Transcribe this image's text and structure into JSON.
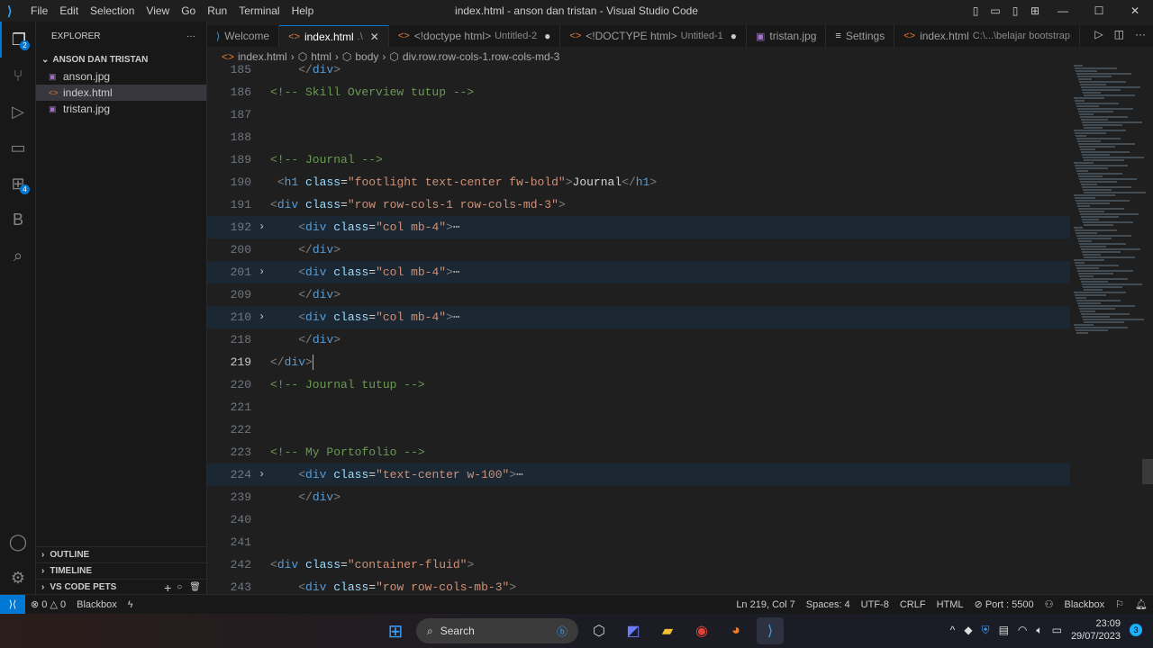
{
  "titlebar": {
    "menu": [
      "File",
      "Edit",
      "Selection",
      "View",
      "Go",
      "Run",
      "Terminal",
      "Help"
    ],
    "title": "index.html - anson dan tristan - Visual Studio Code"
  },
  "activity": {
    "explorer_badge": "2",
    "extensions_badge": "4",
    "blackbox_label": "B"
  },
  "sidebar": {
    "header": "EXPLORER",
    "folder": "ANSON DAN TRISTAN",
    "files": [
      "anson.jpg",
      "index.html",
      "tristan.jpg"
    ],
    "sections": [
      "OUTLINE",
      "TIMELINE",
      "VS CODE PETS"
    ]
  },
  "tabs": [
    {
      "label": "Welcome",
      "sub": "",
      "dot": false
    },
    {
      "label": "index.html",
      "sub": ".\\",
      "dot": false,
      "active": true
    },
    {
      "label": "<!doctype html>",
      "sub": "Untitled-2",
      "dot": true
    },
    {
      "label": "<!DOCTYPE html>",
      "sub": "Untitled-1",
      "dot": true
    },
    {
      "label": "tristan.jpg",
      "sub": "",
      "dot": false
    },
    {
      "label": "Settings",
      "sub": "",
      "dot": false
    },
    {
      "label": "index.html",
      "sub": "C:\\...\\belajar bootstrap",
      "dot": false
    }
  ],
  "breadcrumbs": [
    "index.html",
    "html",
    "body",
    "div.row.row-cols-1.row-cols-md-3"
  ],
  "code_lines": [
    {
      "n": "185",
      "seg": [
        [
          "    ",
          "txt"
        ],
        [
          "</",
          "br"
        ],
        [
          "div",
          "tag"
        ],
        [
          ">",
          "br"
        ]
      ]
    },
    {
      "n": "186",
      "seg": [
        [
          "<!-- Skill Overview tutup -->",
          "com"
        ]
      ]
    },
    {
      "n": "187",
      "seg": []
    },
    {
      "n": "188",
      "seg": []
    },
    {
      "n": "189",
      "seg": [
        [
          "<!-- Journal -->",
          "com"
        ]
      ]
    },
    {
      "n": "190",
      "seg": [
        [
          " ",
          "txt"
        ],
        [
          "<",
          "br"
        ],
        [
          "h1",
          "tag"
        ],
        [
          " ",
          "txt"
        ],
        [
          "class",
          "attr"
        ],
        [
          "=",
          "txt"
        ],
        [
          "\"footlight text-center fw-bold\"",
          "str"
        ],
        [
          ">",
          "br"
        ],
        [
          "Journal",
          "txt"
        ],
        [
          "</",
          "br"
        ],
        [
          "h1",
          "tag"
        ],
        [
          ">",
          "br"
        ]
      ]
    },
    {
      "n": "191",
      "seg": [
        [
          "<",
          "br"
        ],
        [
          "div",
          "tag"
        ],
        [
          " ",
          "txt"
        ],
        [
          "class",
          "attr"
        ],
        [
          "=",
          "txt"
        ],
        [
          "\"row row-cols-1 row-cols-md-3\"",
          "str"
        ],
        [
          ">",
          "br"
        ]
      ]
    },
    {
      "n": "192",
      "fold": true,
      "seg": [
        [
          "    ",
          "txt"
        ],
        [
          "<",
          "br"
        ],
        [
          "div",
          "tag"
        ],
        [
          " ",
          "txt"
        ],
        [
          "class",
          "attr"
        ],
        [
          "=",
          "txt"
        ],
        [
          "\"col mb-4\"",
          "str"
        ],
        [
          ">",
          "br"
        ],
        [
          "⋯",
          "ell"
        ]
      ]
    },
    {
      "n": "200",
      "seg": [
        [
          "    ",
          "txt"
        ],
        [
          "</",
          "br"
        ],
        [
          "div",
          "tag"
        ],
        [
          ">",
          "br"
        ]
      ]
    },
    {
      "n": "201",
      "fold": true,
      "seg": [
        [
          "    ",
          "txt"
        ],
        [
          "<",
          "br"
        ],
        [
          "div",
          "tag"
        ],
        [
          " ",
          "txt"
        ],
        [
          "class",
          "attr"
        ],
        [
          "=",
          "txt"
        ],
        [
          "\"col mb-4\"",
          "str"
        ],
        [
          ">",
          "br"
        ],
        [
          "⋯",
          "ell"
        ]
      ]
    },
    {
      "n": "209",
      "seg": [
        [
          "    ",
          "txt"
        ],
        [
          "</",
          "br"
        ],
        [
          "div",
          "tag"
        ],
        [
          ">",
          "br"
        ]
      ]
    },
    {
      "n": "210",
      "fold": true,
      "seg": [
        [
          "    ",
          "txt"
        ],
        [
          "<",
          "br"
        ],
        [
          "div",
          "tag"
        ],
        [
          " ",
          "txt"
        ],
        [
          "class",
          "attr"
        ],
        [
          "=",
          "txt"
        ],
        [
          "\"col mb-4\"",
          "str"
        ],
        [
          ">",
          "br"
        ],
        [
          "⋯",
          "ell"
        ]
      ]
    },
    {
      "n": "218",
      "seg": [
        [
          "    ",
          "txt"
        ],
        [
          "</",
          "br"
        ],
        [
          "div",
          "tag"
        ],
        [
          ">",
          "br"
        ]
      ]
    },
    {
      "n": "219",
      "current": true,
      "seg": [
        [
          "</",
          "br"
        ],
        [
          "div",
          "tag"
        ],
        [
          ">",
          "br"
        ]
      ]
    },
    {
      "n": "220",
      "seg": [
        [
          "<!-- Journal tutup -->",
          "com"
        ]
      ]
    },
    {
      "n": "221",
      "seg": []
    },
    {
      "n": "222",
      "seg": []
    },
    {
      "n": "223",
      "seg": [
        [
          "<!-- My Portofolio -->",
          "com"
        ]
      ]
    },
    {
      "n": "224",
      "fold": true,
      "seg": [
        [
          "    ",
          "txt"
        ],
        [
          "<",
          "br"
        ],
        [
          "div",
          "tag"
        ],
        [
          " ",
          "txt"
        ],
        [
          "class",
          "attr"
        ],
        [
          "=",
          "txt"
        ],
        [
          "\"text-center w-100\"",
          "str"
        ],
        [
          ">",
          "br"
        ],
        [
          "⋯",
          "ell"
        ]
      ]
    },
    {
      "n": "239",
      "seg": [
        [
          "    ",
          "txt"
        ],
        [
          "</",
          "br"
        ],
        [
          "div",
          "tag"
        ],
        [
          ">",
          "br"
        ]
      ]
    },
    {
      "n": "240",
      "seg": []
    },
    {
      "n": "241",
      "seg": []
    },
    {
      "n": "242",
      "seg": [
        [
          "<",
          "br"
        ],
        [
          "div",
          "tag"
        ],
        [
          " ",
          "txt"
        ],
        [
          "class",
          "attr"
        ],
        [
          "=",
          "txt"
        ],
        [
          "\"container-fluid\"",
          "str"
        ],
        [
          ">",
          "br"
        ]
      ]
    },
    {
      "n": "243",
      "seg": [
        [
          "    ",
          "txt"
        ],
        [
          "<",
          "br"
        ],
        [
          "div",
          "tag"
        ],
        [
          " ",
          "txt"
        ],
        [
          "class",
          "attr"
        ],
        [
          "=",
          "txt"
        ],
        [
          "\"row row-cols-mb-3\"",
          "str"
        ],
        [
          ">",
          "br"
        ]
      ]
    }
  ],
  "status": {
    "errors": "0",
    "warnings": "0",
    "blackbox_left": "Blackbox",
    "position": "Ln 219, Col 7",
    "spaces": "Spaces: 4",
    "encoding": "UTF-8",
    "eol": "CRLF",
    "language": "HTML",
    "port": "Port : 5500",
    "blackbox_right": "Blackbox"
  },
  "taskbar": {
    "search": "Search",
    "time": "23:09",
    "date": "29/07/2023",
    "notifications": "3"
  }
}
